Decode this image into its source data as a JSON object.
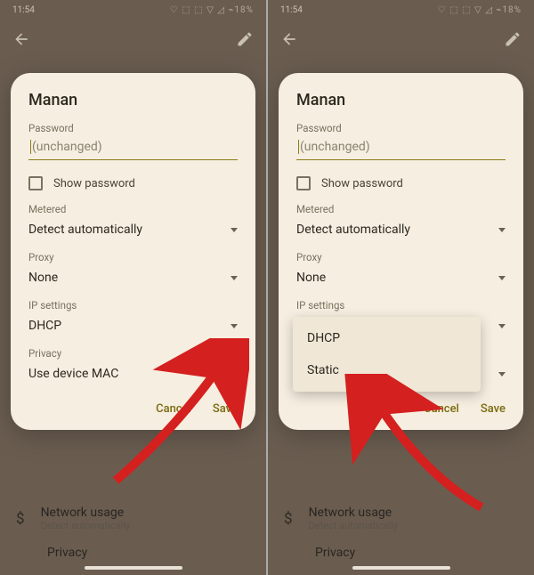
{
  "statusbar": {
    "time": "11:54",
    "right": "♡ ⬚ ⬚    ▽ ◿ ⌁18%"
  },
  "topbar": {},
  "dialog": {
    "title": "Manan",
    "password_label": "Password",
    "password_placeholder": "(unchanged)",
    "show_password": "Show password",
    "metered": {
      "label": "Metered",
      "value": "Detect automatically"
    },
    "proxy": {
      "label": "Proxy",
      "value": "None"
    },
    "ip_settings": {
      "label": "IP settings",
      "value": "DHCP"
    },
    "privacy": {
      "label": "Privacy",
      "value": "Use device MAC"
    },
    "cancel": "Cancel",
    "save": "Save"
  },
  "ip_dropdown": {
    "dhcp": "DHCP",
    "static": "Static"
  },
  "bg": {
    "network_usage": {
      "title": "Network usage",
      "sub": "Detect automatically"
    },
    "privacy": {
      "title": "Privacy"
    }
  }
}
